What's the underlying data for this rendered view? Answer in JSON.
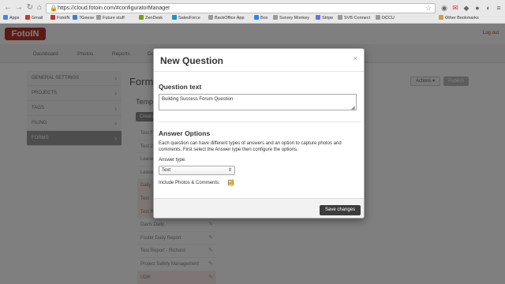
{
  "browser": {
    "url": "https://cloud.fotoin.com/#configuratorManager",
    "bookmarks": [
      {
        "label": "Apps",
        "color": "#4285f4"
      },
      {
        "label": "Gmail",
        "color": "#d93025"
      },
      {
        "label": "FotoIN",
        "color": "#b8342a"
      },
      {
        "label": "7Geese",
        "color": "#3a7bd5"
      },
      {
        "label": "Future stuff",
        "color": "#999999"
      },
      {
        "label": "ZenDesk",
        "color": "#78a300"
      },
      {
        "label": "SalesForce",
        "color": "#1798c1"
      },
      {
        "label": "BackOffice App",
        "color": "#999999"
      },
      {
        "label": "Box",
        "color": "#2486fc"
      },
      {
        "label": "Survey Monkey",
        "color": "#999999"
      },
      {
        "label": "Stripe",
        "color": "#6772e5"
      },
      {
        "label": "SVB Connect",
        "color": "#999999"
      },
      {
        "label": "DCCU",
        "color": "#999999"
      }
    ],
    "other_bookmarks": "Other Bookmarks"
  },
  "app": {
    "logo_text": "FotoIN",
    "logout": "Log out",
    "nav_tabs": [
      "Dashboard",
      "Photos",
      "Reports",
      "Da"
    ],
    "sidebar": [
      {
        "label": "GENERAL SETTINGS",
        "active": false
      },
      {
        "label": "PROJECTS",
        "active": false
      },
      {
        "label": "TAGS",
        "active": false
      },
      {
        "label": "FILING",
        "active": false
      },
      {
        "label": "FORMS",
        "active": true
      }
    ],
    "content_title": "Form",
    "actions_label": "Actions ▾",
    "publish_label": "Publish",
    "templates_label": "Templ",
    "create_label": "Create",
    "templates": [
      {
        "name": "Test F",
        "highlight": false
      },
      {
        "name": "Test 2",
        "highlight": false
      },
      {
        "name": "Lease",
        "highlight": false
      },
      {
        "name": "Lease",
        "highlight": false
      },
      {
        "name": "Daily",
        "highlight": true
      },
      {
        "name": "Test",
        "highlight": true
      },
      {
        "name": "Test R",
        "highlight": true
      },
      {
        "name": "Davis Daily",
        "highlight": false
      },
      {
        "name": "Foster Daily Report",
        "highlight": false
      },
      {
        "name": "Test Report - Richard",
        "highlight": false
      },
      {
        "name": "Project Safety Management",
        "highlight": false
      },
      {
        "name": "UDR",
        "highlight": true
      }
    ]
  },
  "modal": {
    "title": "New Question",
    "close": "×",
    "question_text_label": "Question text",
    "question_text_value": "Building Success Forum Question",
    "answer_options_title": "Answer Options",
    "answer_options_desc": "Each question can have different types of answers and an option to capture photos and comments. First select the Answer type then configure the options.",
    "answer_type_label": "Answer type:",
    "answer_type_value": "Text",
    "include_photos_label": "Include Photos & Comments:",
    "save_label": "Save changes"
  }
}
